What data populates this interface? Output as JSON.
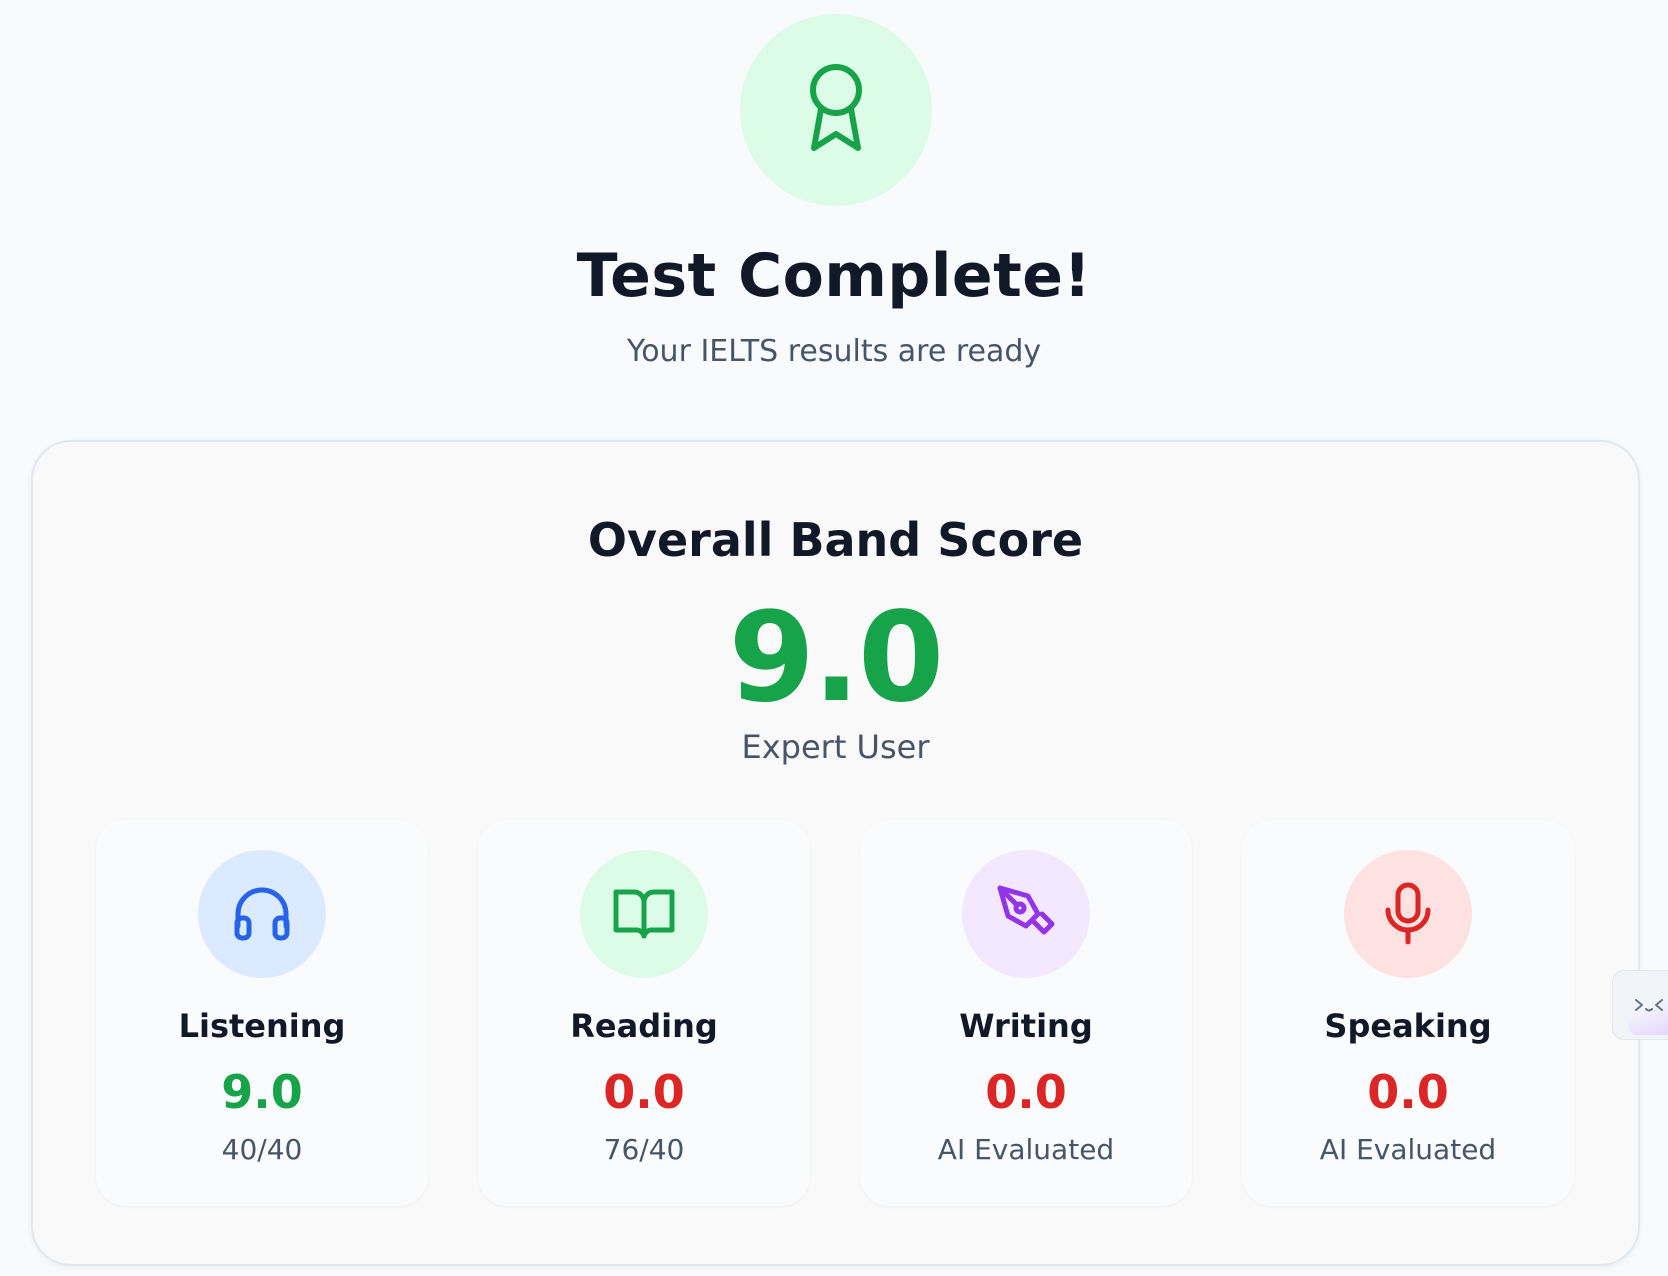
{
  "header": {
    "icon": "award-icon",
    "title": "Test Complete!",
    "subtitle": "Your IELTS results are ready"
  },
  "overall": {
    "label": "Overall Band Score",
    "score": "9.0",
    "level": "Expert User"
  },
  "skills": [
    {
      "name": "Listening",
      "score": "9.0",
      "detail": "40/40",
      "icon": "headphones-icon",
      "score_color": "#16a34a",
      "icon_color": "#2563eb",
      "bg": "#dbeafe"
    },
    {
      "name": "Reading",
      "score": "0.0",
      "detail": "76/40",
      "icon": "book-open-icon",
      "score_color": "#dc2626",
      "icon_color": "#16a34a",
      "bg": "#dcfce7"
    },
    {
      "name": "Writing",
      "score": "0.0",
      "detail": "AI Evaluated",
      "icon": "pen-tool-icon",
      "score_color": "#dc2626",
      "icon_color": "#9333ea",
      "bg": "#f3e8ff"
    },
    {
      "name": "Speaking",
      "score": "0.0",
      "detail": "AI Evaluated",
      "icon": "microphone-icon",
      "score_color": "#dc2626",
      "icon_color": "#dc2626",
      "bg": "#fee2e2"
    }
  ],
  "colors": {
    "accent_green": "#16a34a",
    "accent_red": "#dc2626",
    "page_bg": "#f8fafc",
    "muted_text": "#475569"
  },
  "side_tab": {
    "icon": "code-collapse-icon"
  }
}
